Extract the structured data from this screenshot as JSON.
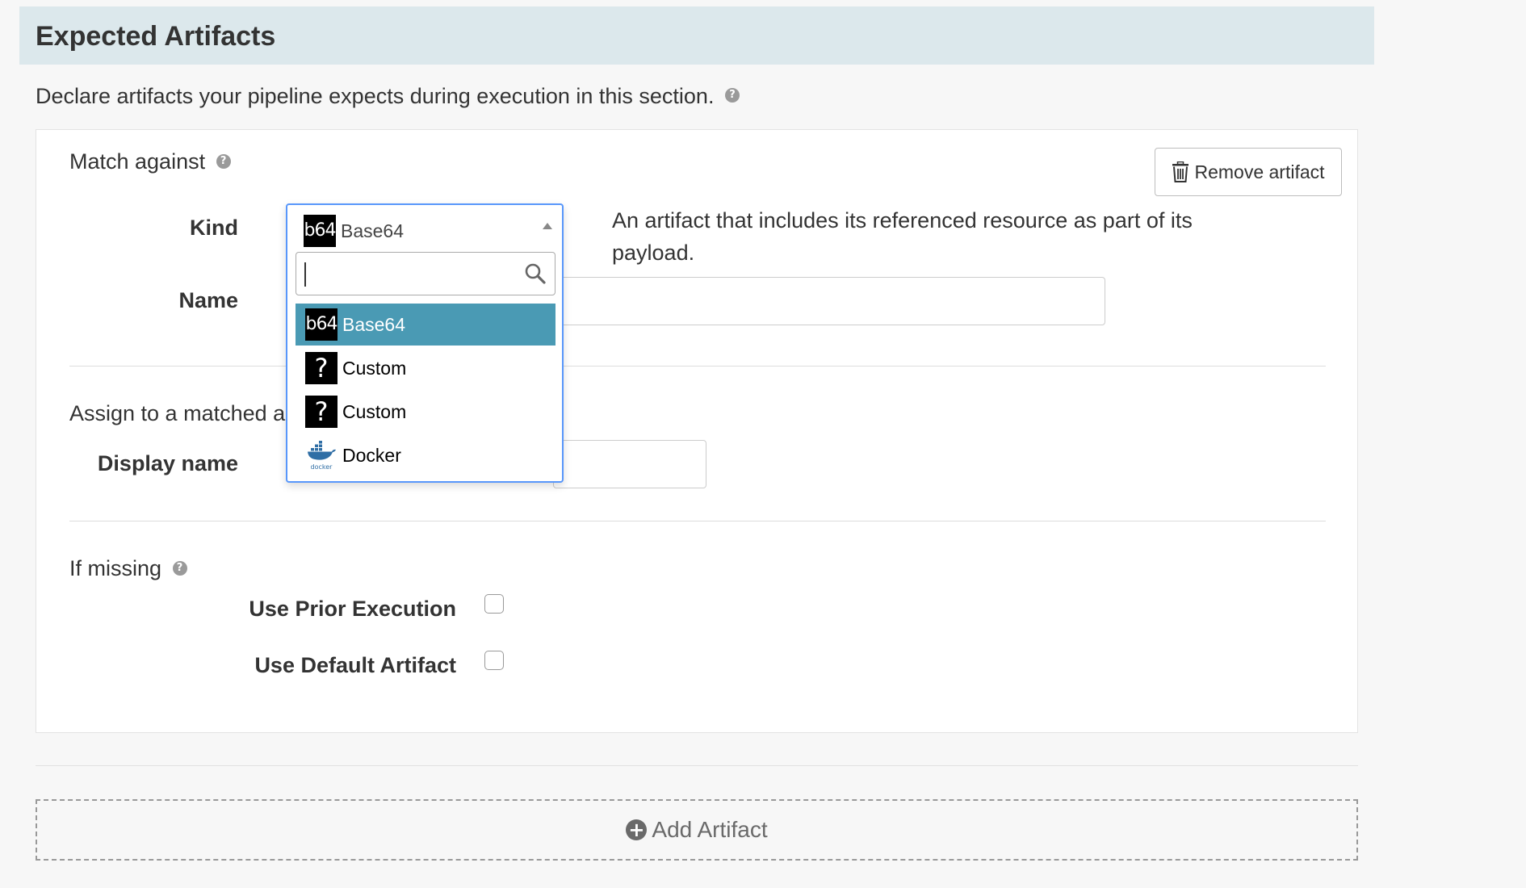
{
  "section": {
    "title": "Expected Artifacts",
    "description": "Declare artifacts your pipeline expects during execution in this section.",
    "help_icon": "question-circle-icon"
  },
  "artifact": {
    "match_against_label": "Match against",
    "remove_button_label": "Remove artifact",
    "remove_icon": "trash-icon",
    "kind_label": "Kind",
    "name_label": "Name",
    "kind_description": "An artifact that includes its referenced resource as part of its payload.",
    "name_value": "",
    "assign_label": "Assign to a matched art",
    "display_name_label": "Display name",
    "display_name_value": "",
    "if_missing_label": "If missing",
    "use_prior_execution_label": "Use Prior Execution",
    "use_prior_execution_checked": false,
    "use_default_artifact_label": "Use Default Artifact",
    "use_default_artifact_checked": false
  },
  "kind_select": {
    "selected": {
      "badge": "b64",
      "label": "Base64"
    },
    "search_value": "",
    "options": [
      {
        "badge": "b64",
        "icon": "base64-icon",
        "label": "Base64",
        "highlighted": true
      },
      {
        "badge": "?",
        "icon": "question-icon",
        "label": "Custom",
        "highlighted": false
      },
      {
        "badge": "?",
        "icon": "question-icon",
        "label": "Custom",
        "highlighted": false
      },
      {
        "badge": "docker",
        "icon": "docker-icon",
        "label": "Docker",
        "highlighted": false
      }
    ]
  },
  "add_artifact": {
    "label": "Add Artifact",
    "icon": "plus-circle-icon"
  },
  "colors": {
    "header_bg": "#dce8ec",
    "highlight": "#4a9ab4",
    "select_border": "#5897fb",
    "docker_blue": "#2f6ea5"
  }
}
